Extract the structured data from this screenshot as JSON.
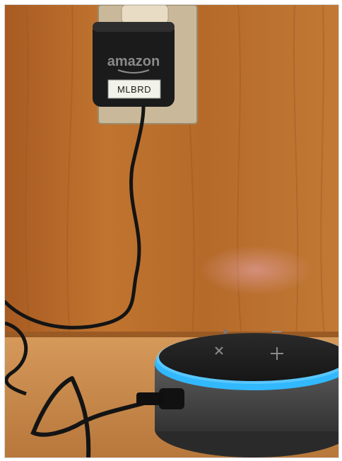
{
  "photo": {
    "adapter_brand": "amazon",
    "adapter_label": "MLBRD",
    "colors": {
      "wood": "#b8692d",
      "shelf": "#c98a4c",
      "adapter": "#1b1b1b",
      "cable": "#141414",
      "speaker_fabric": "#4a4a4a",
      "speaker_top": "#1f1f1f",
      "light_ring": "#32b8ff"
    }
  }
}
